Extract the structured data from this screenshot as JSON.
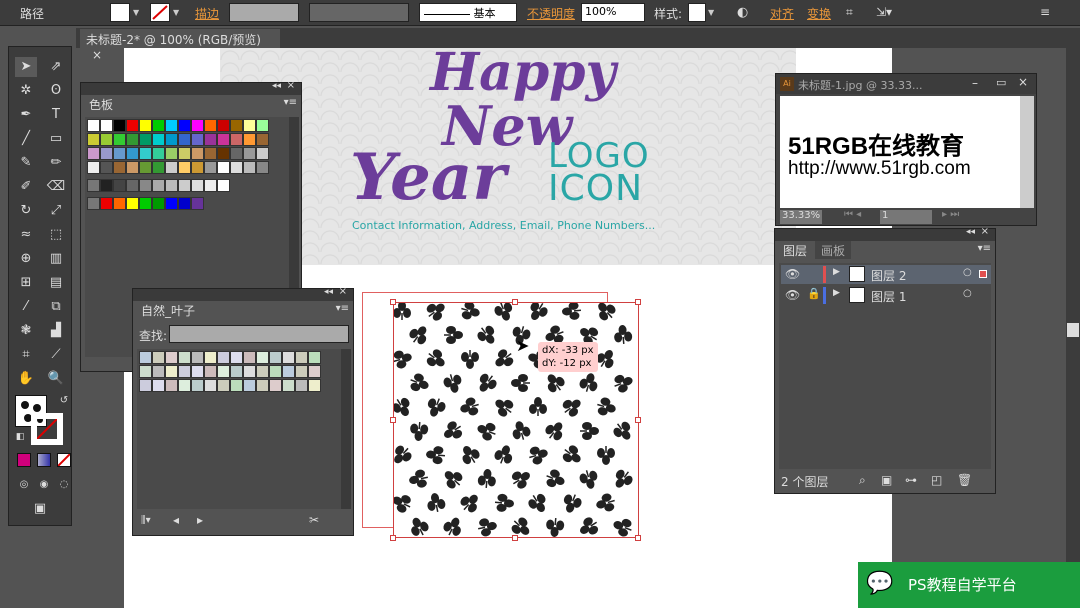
{
  "control_bar": {
    "object_label": "路径",
    "stroke_label": "描边",
    "stroke_style": "基本",
    "opacity_label": "不透明度",
    "opacity_value": "100%",
    "style_label": "样式:",
    "align_label": "对齐",
    "transform_label": "变换"
  },
  "document": {
    "tab_title": "未标题-2* @ 100% (RGB/预览)"
  },
  "artwork": {
    "line1": "Happy",
    "line2": "New",
    "line3": "Year",
    "logo_top": "LOGO",
    "logo_bottom": "ICON",
    "contact": "Contact Information, Address, Email, Phone Numbers..."
  },
  "tooltip": {
    "dx": "dX: -33 px",
    "dy": "dY: -12 px"
  },
  "swatches_panel": {
    "title": "色板"
  },
  "pattern_panel": {
    "title": "自然_叶子",
    "search_label": "查找:",
    "search_value": ""
  },
  "preview_window": {
    "title": "未标题-1.jpg @ 33.33...",
    "headline": "51RGB在线教育",
    "url": "http://www.51rgb.com",
    "zoom": "33.33%",
    "page": "1"
  },
  "layers_panel": {
    "tab_layers": "图层",
    "tab_artboards": "画板",
    "layers": [
      {
        "name": "图层 2",
        "color": "#e05050"
      },
      {
        "name": "图层 1",
        "color": "#4a6ee0"
      }
    ],
    "footer": "2 个图层"
  },
  "watermark": {
    "text": "PS教程自学平台"
  },
  "colors": {
    "fill_swatch": "#d0007c",
    "accent_purple": "#6c3d9a",
    "accent_teal": "#2aa6a6"
  }
}
